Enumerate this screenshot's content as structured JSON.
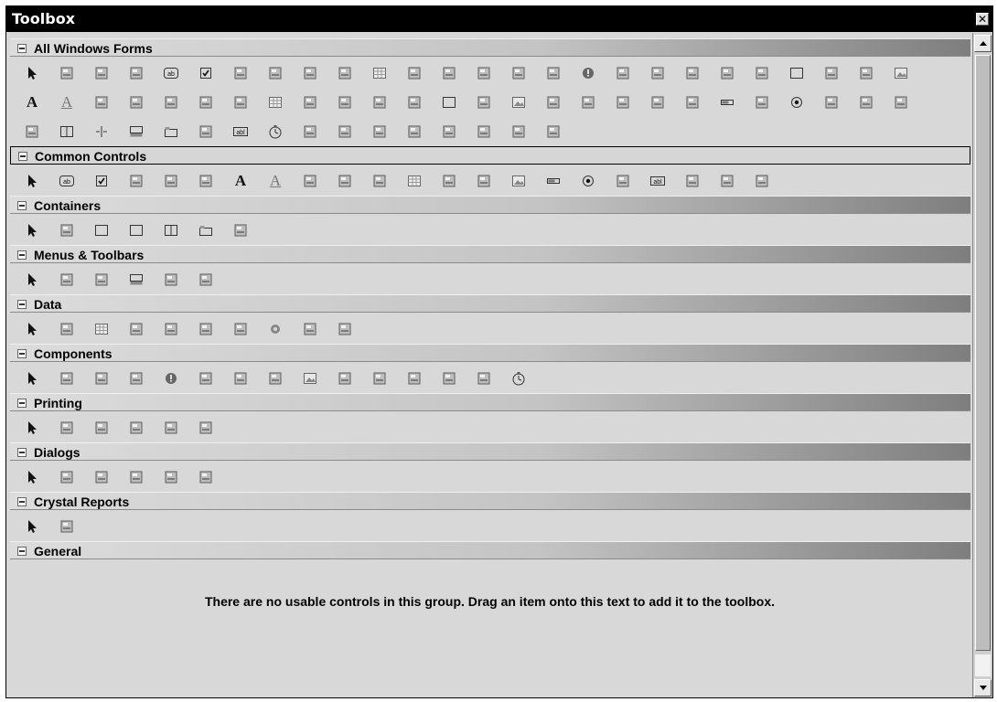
{
  "window": {
    "title": "Toolbox",
    "close_glyph": "✕"
  },
  "groups": [
    {
      "label": "All Windows Forms",
      "active": false,
      "rows": [
        [
          "pointer-icon",
          "backgroundworker-icon",
          "bindingnavigator-icon",
          "bindingsource-icon",
          "button-icon",
          "checkbox-icon",
          "checkedlistbox-icon",
          "colordialog-icon",
          "combobox-icon",
          "contextmenustrip-icon",
          "datagridview-icon",
          "dataset-icon",
          "datetimepicker-icon",
          "directoryentry-icon",
          "directorysearcher-icon",
          "domainupdown-icon",
          "errorprovider-icon",
          "eventlog-icon",
          "filesystemwatcher-icon",
          "flowlayoutpanel-icon",
          "folderbrowserdialog-icon",
          "fontdialog-icon",
          "groupbox-icon",
          "helpprovider-icon",
          "hscrollbar-icon",
          "imagelist-icon"
        ],
        [
          "label-icon",
          "linklabel-icon",
          "listbox-icon",
          "listview-icon",
          "maskedtextbox-icon",
          "menustrip-icon",
          "messagequeue-icon",
          "monthcalendar-icon",
          "notifyicon-icon",
          "numericupdown-icon",
          "openfiledialog-icon",
          "pagesetupdialog-icon",
          "panel-icon",
          "performancecounter-icon",
          "picturebox-icon",
          "printdialog-icon",
          "printdocument-icon",
          "printpreviewcontrol-icon",
          "printpreviewdialog-icon",
          "process-icon",
          "progressbar-icon",
          "propertygrid-icon",
          "radiobutton-icon",
          "richtextbox-icon",
          "savefiledialog-icon",
          "serialport-icon"
        ],
        [
          "servicecontroller-icon",
          "splitcontainer-icon",
          "splitter-icon",
          "statusstrip-icon",
          "tabcontrol-icon",
          "tablelayoutpanel-icon",
          "textbox-icon",
          "timer-icon",
          "toolstrip-icon",
          "toolstripcontainer-icon",
          "tooltip-icon",
          "trackbar-icon",
          "treeview-icon",
          "vscrollbar-icon",
          "webbrowser-icon",
          "reportviewer-icon"
        ]
      ]
    },
    {
      "label": "Common Controls",
      "active": true,
      "rows": [
        [
          "pointer-icon",
          "button-icon",
          "checkbox-icon",
          "checkedlistbox-icon",
          "combobox-icon",
          "datetimepicker-icon",
          "label-icon",
          "linklabel-icon",
          "listbox-icon",
          "listview-icon",
          "maskedtextbox-icon",
          "monthcalendar-icon",
          "notifyicon-icon",
          "numericupdown-icon",
          "picturebox-icon",
          "progressbar-icon",
          "radiobutton-icon",
          "richtextbox-icon",
          "textbox-icon",
          "tooltip-icon",
          "treeview-icon",
          "webbrowser-icon"
        ]
      ]
    },
    {
      "label": "Containers",
      "active": false,
      "rows": [
        [
          "pointer-icon",
          "flowlayoutpanel-icon",
          "groupbox-icon",
          "panel-icon",
          "splitcontainer-icon",
          "tabcontrol-icon",
          "tablelayoutpanel-icon"
        ]
      ]
    },
    {
      "label": "Menus & Toolbars",
      "active": false,
      "rows": [
        [
          "pointer-icon",
          "contextmenustrip-icon",
          "menustrip-icon",
          "statusstrip-icon",
          "toolstrip-icon",
          "toolstripcontainer-icon"
        ]
      ]
    },
    {
      "label": "Data",
      "active": false,
      "rows": [
        [
          "pointer-icon",
          "dataset-icon",
          "datagridview-icon",
          "bindingsource-icon",
          "bindingnavigator-icon",
          "reportviewer-icon",
          "add-connection-icon",
          "gear-icon",
          "sqlconnection-icon",
          "sqldataadapter-icon"
        ]
      ]
    },
    {
      "label": "Components",
      "active": false,
      "rows": [
        [
          "pointer-icon",
          "backgroundworker-icon",
          "directoryentry-icon",
          "directorysearcher-icon",
          "errorprovider-icon",
          "eventlog-icon",
          "filesystemwatcher-icon",
          "helpprovider-icon",
          "imagelist-icon",
          "messagequeue-icon",
          "performancecounter-icon",
          "process-icon",
          "serialport-icon",
          "servicecontroller-icon",
          "timer-icon"
        ]
      ]
    },
    {
      "label": "Printing",
      "active": false,
      "rows": [
        [
          "pointer-icon",
          "pagesetupdialog-icon",
          "printdialog-icon",
          "printdocument-icon",
          "printpreviewcontrol-icon",
          "printpreviewdialog-icon"
        ]
      ]
    },
    {
      "label": "Dialogs",
      "active": false,
      "rows": [
        [
          "pointer-icon",
          "colordialog-icon",
          "folderbrowserdialog-icon",
          "fontdialog-icon",
          "openfiledialog-icon",
          "savefiledialog-icon"
        ]
      ]
    },
    {
      "label": "Crystal Reports",
      "active": false,
      "rows": [
        [
          "pointer-icon",
          "crystalreportviewer-icon"
        ]
      ]
    },
    {
      "label": "General",
      "active": false,
      "rows": [],
      "empty_message": "There are no usable controls in this group. Drag an item onto this text to add it to the toolbox."
    }
  ]
}
